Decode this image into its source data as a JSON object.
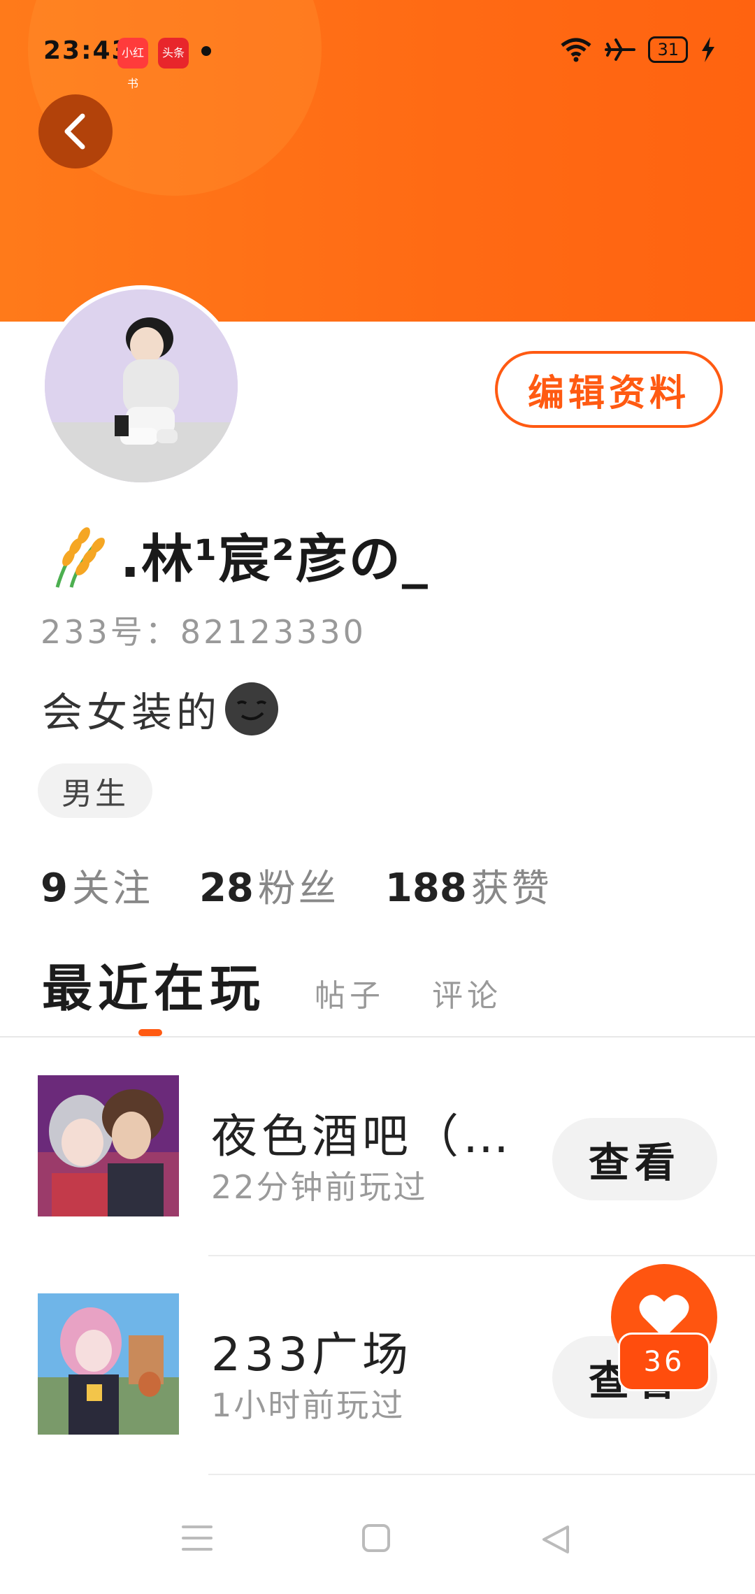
{
  "status_bar": {
    "time": "23:43",
    "app_icons": [
      "小红书",
      "头条"
    ],
    "battery": "31"
  },
  "profile": {
    "nickname": ".林¹宸²彦の_",
    "uid": "233号：82123330",
    "bio": "会女装的",
    "gender": "男生",
    "edit_label": "编辑资料"
  },
  "stats": [
    {
      "num": "9",
      "label": "关注"
    },
    {
      "num": "28",
      "label": "粉丝"
    },
    {
      "num": "188",
      "label": "获赞"
    }
  ],
  "tabs": [
    "最近在玩",
    "帖子",
    "评论"
  ],
  "games": [
    {
      "title": "夜色酒吧（…",
      "time": "22分钟前玩过",
      "action": "查看"
    },
    {
      "title": "233广场",
      "time": "1小时前玩过",
      "action": "查看"
    }
  ],
  "like_fab": {
    "count": "36"
  },
  "colors": {
    "accent": "#ff5a12",
    "header": "#ff7416"
  }
}
